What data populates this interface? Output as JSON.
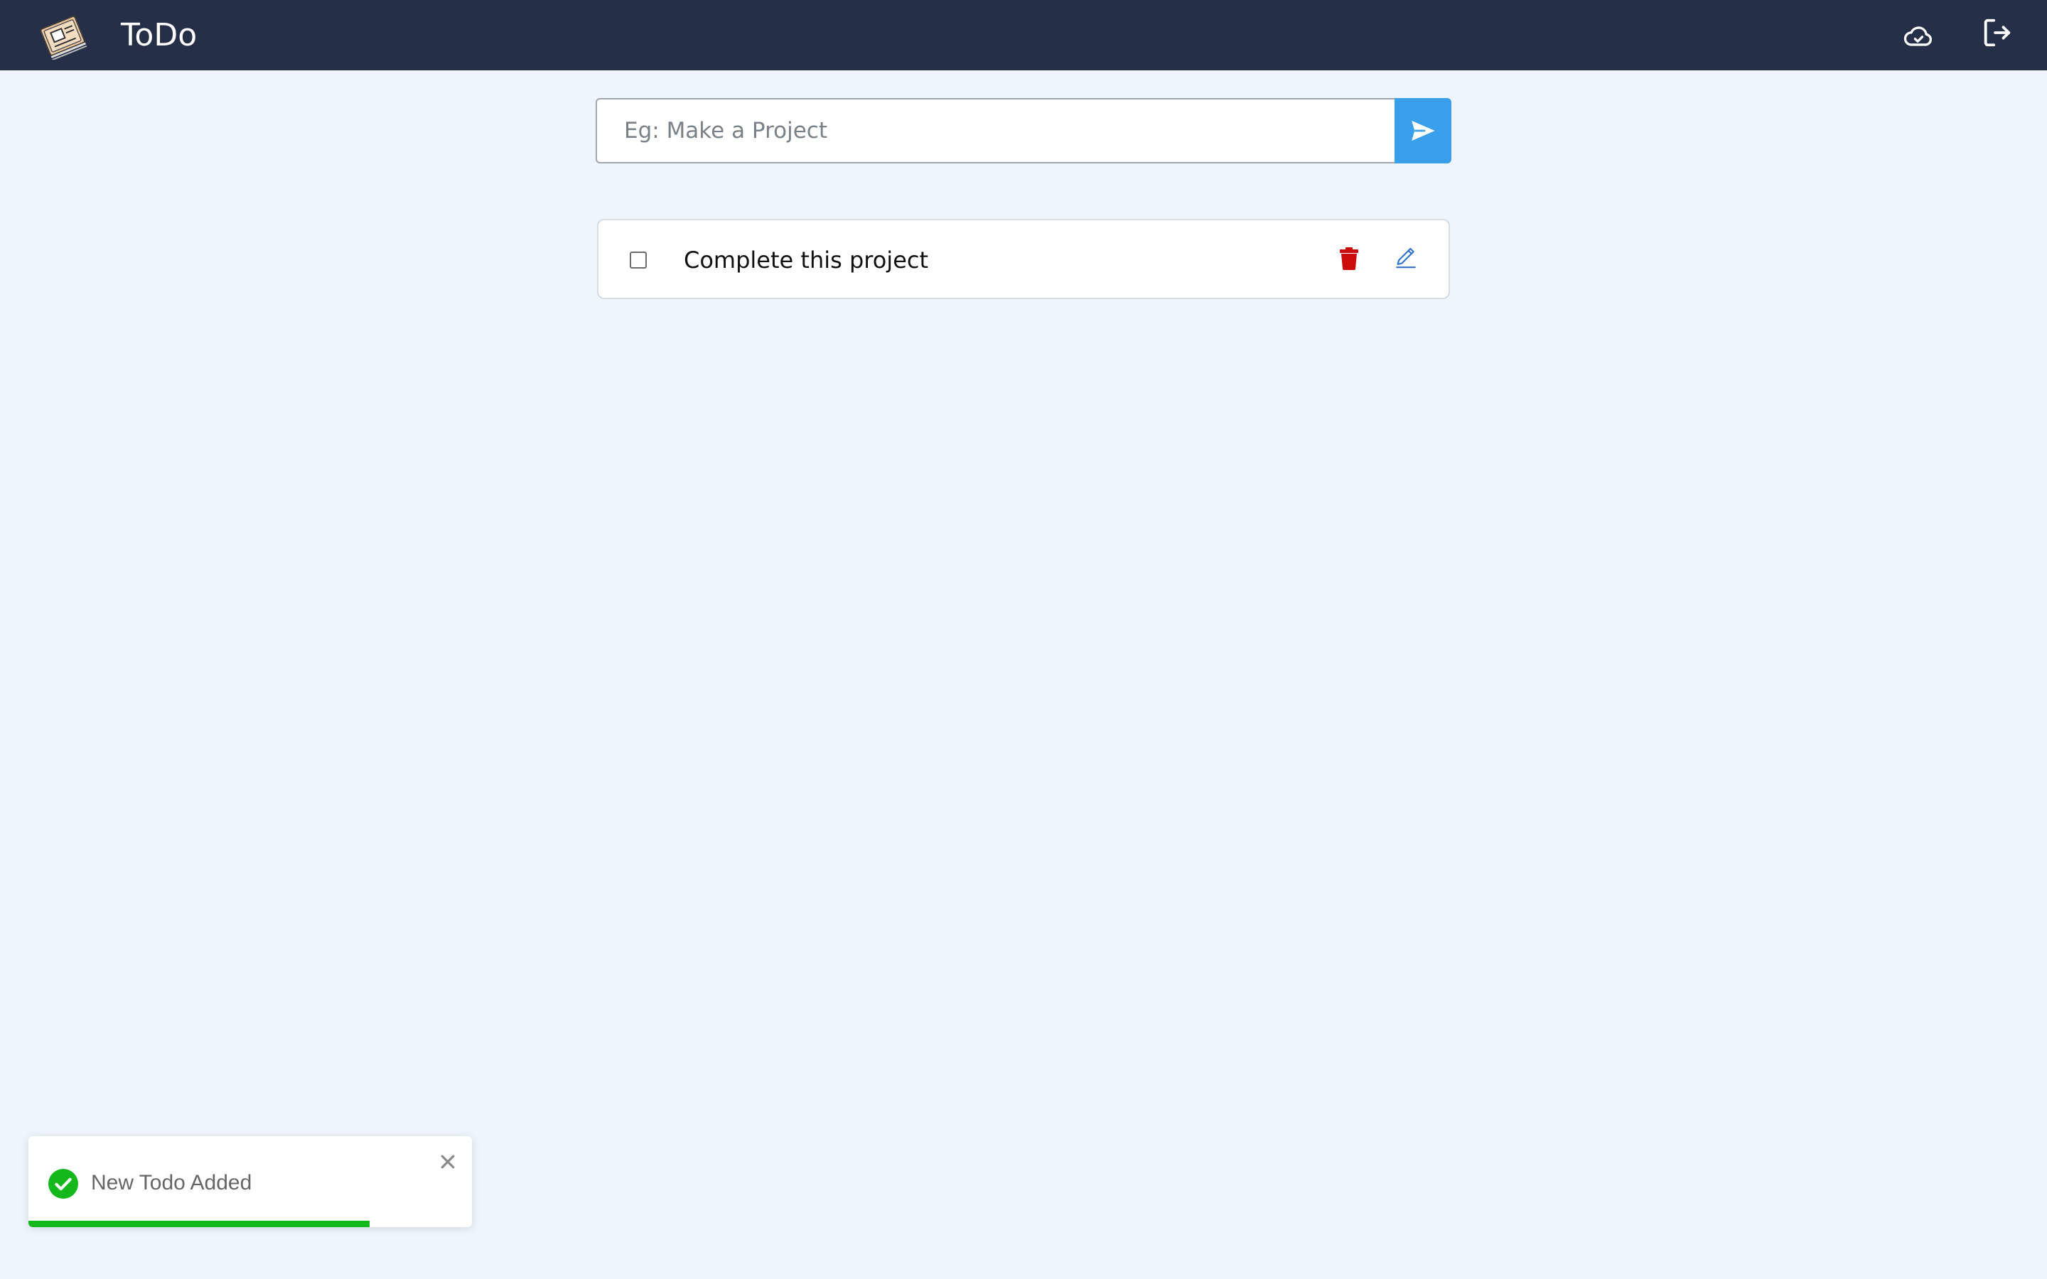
{
  "navbar": {
    "title": "ToDo",
    "logo_icon": "notebook-logo-icon",
    "cloud_icon": "cloud-sync-icon",
    "logout_icon": "logout-icon",
    "background": "#262f48"
  },
  "add_form": {
    "placeholder": "Eg: Make a Project",
    "value": "",
    "submit_icon": "send-icon",
    "submit_color": "#3a9fea"
  },
  "todos": [
    {
      "text": "Complete this project",
      "completed": false,
      "delete_icon": "trash-icon",
      "edit_icon": "pencil-icon"
    }
  ],
  "toast": {
    "message": "New Todo Added",
    "status_icon": "check-circle-icon",
    "close_icon": "close-icon",
    "progress": 0.77,
    "accent": "#14b81b"
  },
  "colors": {
    "page_background": "#eef5fd",
    "delete": "#cc0b0b",
    "edit": "#2f74c8"
  }
}
